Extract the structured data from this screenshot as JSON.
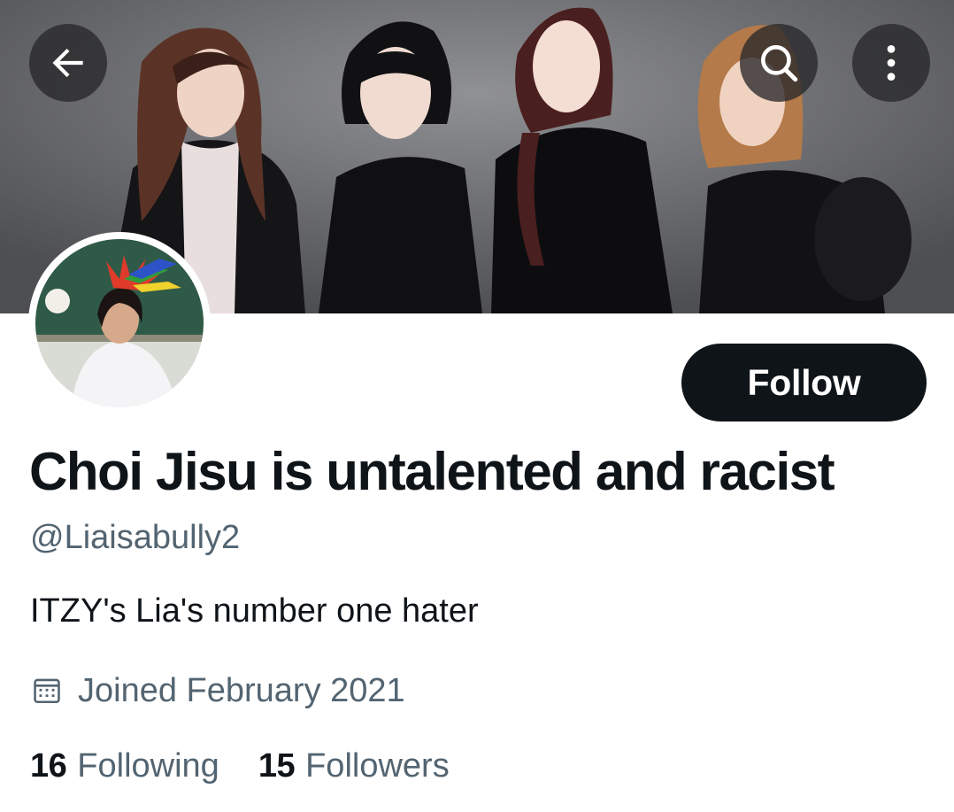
{
  "profile": {
    "display_name": "Choi Jisu is untalented and racist",
    "handle": "@Liaisabully2",
    "bio": "ITZY's Lia's number one hater",
    "joined": "Joined February 2021"
  },
  "actions": {
    "follow_label": "Follow"
  },
  "stats": {
    "following_count": "16",
    "following_label": "Following",
    "followers_count": "15",
    "followers_label": "Followers"
  },
  "icons": {
    "back": "arrow-left-icon",
    "search": "search-icon",
    "more": "more-vertical-icon",
    "calendar": "calendar-icon"
  },
  "colors": {
    "text_primary": "#0f1419",
    "text_secondary": "#536471",
    "button_dark": "#0f1419"
  }
}
